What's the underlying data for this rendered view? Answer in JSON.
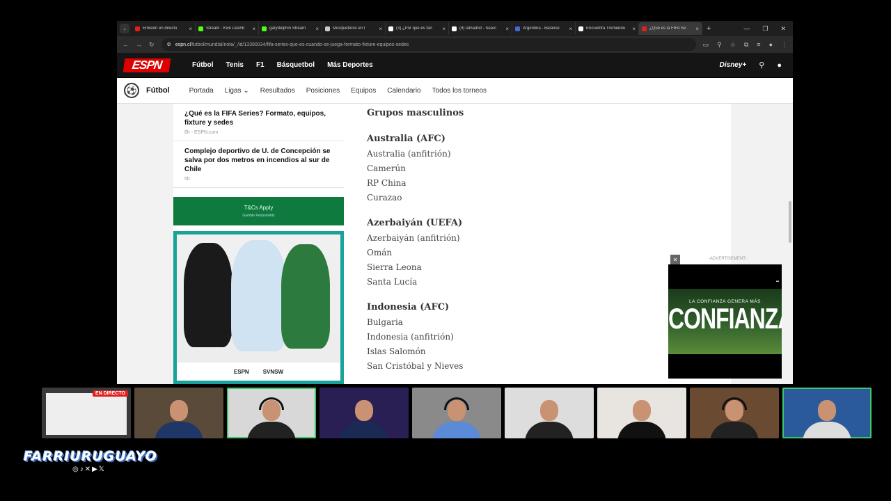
{
  "browser": {
    "tabs": [
      {
        "title": "Emisión en directo",
        "color": "#e02020"
      },
      {
        "title": "Stream - Kick Dashb",
        "color": "#53fc18"
      },
      {
        "title": "garydelphin Stream",
        "color": "#53fc18"
      },
      {
        "title": "Mosqueteros en I",
        "color": "#cccccc"
      },
      {
        "title": "(3) ¿Por qué es tan",
        "color": "#ffffff"
      },
      {
        "title": "(9) lamadrid - Searc",
        "color": "#ffffff"
      },
      {
        "title": "Argentina - Balance",
        "color": "#4a66d8"
      },
      {
        "title": "Encuentra Tremendo",
        "color": "#ffffff"
      },
      {
        "title": "¿Qué es la FIFA Se",
        "color": "#e02020"
      }
    ],
    "url_host": "espn.cl",
    "url_path": "/futbol/mundial/nota/_/id/13390034/fifa-series-que-es-cuando-se-juega-formato-fixture-equipos-sedes"
  },
  "espn": {
    "logo": "ESPN",
    "nav": [
      "Fútbol",
      "Tenis",
      "F1",
      "Básquetbol",
      "Más Deportes"
    ],
    "section_title": "Fútbol",
    "subnav": [
      "Portada",
      "Ligas ⌄",
      "Resultados",
      "Posiciones",
      "Equipos",
      "Calendario",
      "Todos los torneos"
    ]
  },
  "sidebar": {
    "news": [
      {
        "title": "¿Qué es la FIFA Series? Formato, equipos, fixture y sedes",
        "meta": "6h - ESPN.com"
      },
      {
        "title": "Complejo deportivo de U. de Concepción se salva por dos metros en incendios al sur de Chile",
        "meta": "5h"
      }
    ],
    "promo": {
      "line1": "T&Cs Apply",
      "line2": "Gamble Responsibly"
    },
    "poster_foot": {
      "left": "ESPN",
      "right": "SVNSW"
    }
  },
  "article": {
    "heading": "Grupos masculinos",
    "groups": [
      {
        "title": "Australia (AFC)",
        "teams": [
          "Australia (anfitrión)",
          "Camerún",
          "RP China",
          "Curazao"
        ]
      },
      {
        "title": "Azerbaiyán (UEFA)",
        "teams": [
          "Azerbaiyán (anfitrión)",
          "Omán",
          "Sierra Leona",
          "Santa Lucía"
        ]
      },
      {
        "title": "Indonesia (AFC)",
        "teams": [
          "Bulgaria",
          "Indonesia (anfitrión)",
          "Islas Salomón",
          "San Cristóbal y Nieves"
        ]
      }
    ]
  },
  "ad": {
    "label": "-ADVERTISEMENT-",
    "line1": "LA CONFIANZA GENERA MÁS",
    "line2": "CONFIANZA"
  },
  "stream": {
    "live_badge": "EN DIRECTO",
    "brand": "FARRIURUGUAYO",
    "social": "◎♪✕▶𝕏"
  }
}
